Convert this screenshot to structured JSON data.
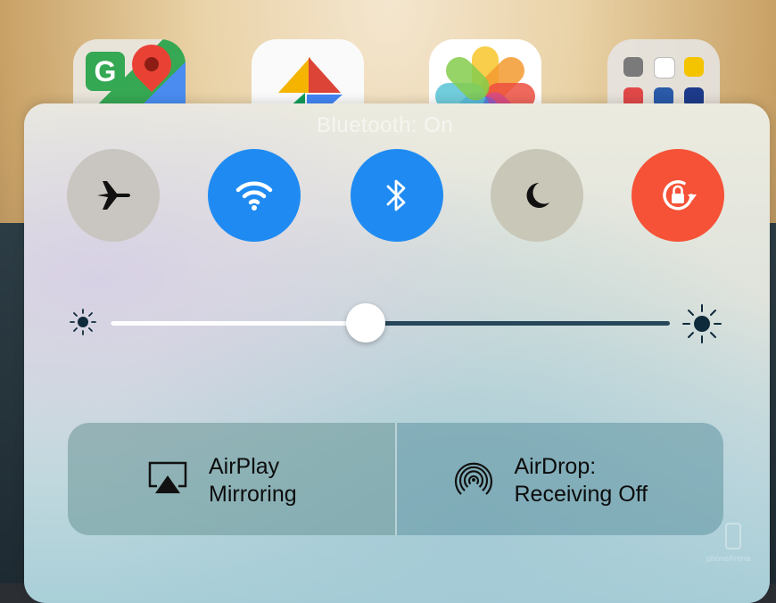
{
  "homescreen": {
    "apps": [
      {
        "name": "Google Maps",
        "icon": "google-maps-icon"
      },
      {
        "name": "Google Photos",
        "icon": "google-photos-icon"
      },
      {
        "name": "Photos",
        "icon": "photos-icon"
      },
      {
        "name": "Folder",
        "icon": "app-folder-icon"
      }
    ],
    "maps_letter": "G"
  },
  "control_center": {
    "status_overlay": "Bluetooth: On",
    "toggles": [
      {
        "id": "airplane",
        "icon": "airplane-icon",
        "state": "off",
        "color": "#c9c6c1"
      },
      {
        "id": "wifi",
        "icon": "wifi-icon",
        "state": "on",
        "color": "#1f8bf2"
      },
      {
        "id": "bluetooth",
        "icon": "bluetooth-icon",
        "state": "on",
        "color": "#1f8bf2"
      },
      {
        "id": "do-not-disturb",
        "icon": "moon-icon",
        "state": "off",
        "color": "#c8c7b8"
      },
      {
        "id": "rotation-lock",
        "icon": "rotation-lock-icon",
        "state": "on",
        "color": "#f55237"
      }
    ],
    "brightness": {
      "value": 0.456,
      "min_icon": "sun-small-icon",
      "max_icon": "sun-large-icon"
    },
    "actions": {
      "airplay": {
        "label_line1": "AirPlay",
        "label_line2": "Mirroring",
        "icon": "airplay-icon"
      },
      "airdrop": {
        "label_line1": "AirDrop:",
        "label_line2": "Receiving Off",
        "icon": "airdrop-icon"
      }
    }
  },
  "watermark": {
    "text": "phoneArena"
  }
}
